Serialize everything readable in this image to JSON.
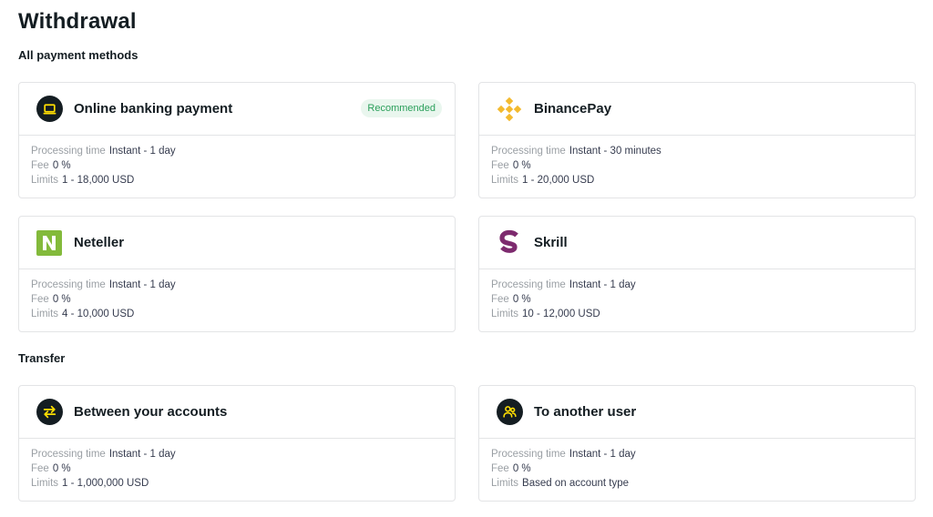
{
  "page": {
    "title": "Withdrawal"
  },
  "sections": {
    "payment_methods": "All payment methods",
    "transfer": "Transfer"
  },
  "field_labels": {
    "processing_time": "Processing time",
    "fee": "Fee",
    "limits": "Limits"
  },
  "cards": {
    "online_banking": {
      "name": "Online banking payment",
      "badge": "Recommended",
      "icon": "laptop-icon",
      "processing_time": "Instant - 1 day",
      "fee": "0 %",
      "limits": "1 - 18,000 USD"
    },
    "binancepay": {
      "name": "BinancePay",
      "icon": "binance-logo-icon",
      "processing_time": "Instant - 30 minutes",
      "fee": "0 %",
      "limits": "1 - 20,000 USD"
    },
    "neteller": {
      "name": "Neteller",
      "icon": "neteller-logo-icon",
      "processing_time": "Instant - 1 day",
      "fee": "0 %",
      "limits": "4 - 10,000 USD"
    },
    "skrill": {
      "name": "Skrill",
      "icon": "skrill-logo-icon",
      "processing_time": "Instant - 1 day",
      "fee": "0 %",
      "limits": "10 - 12,000 USD"
    },
    "between_accounts": {
      "name": "Between your accounts",
      "icon": "transfer-arrows-icon",
      "processing_time": "Instant - 1 day",
      "fee": "0 %",
      "limits": "1 - 1,000,000 USD"
    },
    "another_user": {
      "name": "To another user",
      "icon": "users-icon",
      "processing_time": "Instant - 1 day",
      "fee": "0 %",
      "limits": "Based on account type"
    }
  },
  "colors": {
    "icon_accent": "#ffde02",
    "binance": "#f3ba2f",
    "neteller": "#83ba3b",
    "skrill": "#7d2a6e",
    "badge_bg": "#e9f6ee",
    "badge_text": "#2b9f5b"
  }
}
